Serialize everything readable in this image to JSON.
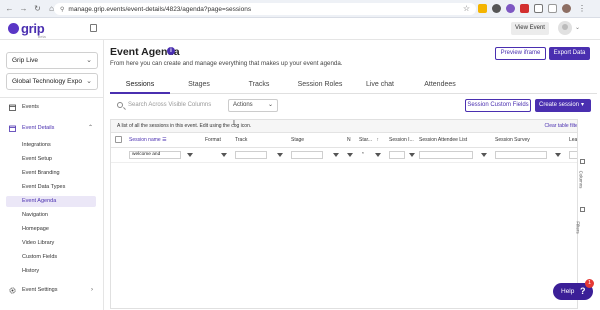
{
  "browser": {
    "url": "manage.grip.events/event-details/4823/agenda?page=sessions",
    "extension_colors": [
      "#f4b400",
      "#555555",
      "#7e57c2",
      "#d32f2f",
      "#777777"
    ]
  },
  "header": {
    "logo_text": "grip",
    "logo_sub": "beta",
    "view_event_label": "View Event"
  },
  "sidebar": {
    "org_select": "Grip Live",
    "event_select": "Global Technology Expo",
    "items": [
      {
        "label": "Events",
        "icon": "calendar-icon"
      },
      {
        "label": "Event Details",
        "icon": "calendar-icon"
      },
      {
        "label": "Integrations"
      },
      {
        "label": "Event Setup"
      },
      {
        "label": "Event Branding"
      },
      {
        "label": "Event Data Types"
      },
      {
        "label": "Event Agenda"
      },
      {
        "label": "Navigation"
      },
      {
        "label": "Homepage"
      },
      {
        "label": "Video Library"
      },
      {
        "label": "Custom Fields"
      },
      {
        "label": "History"
      },
      {
        "label": "Event Settings",
        "icon": "gear-icon"
      }
    ]
  },
  "main": {
    "title": "Event Agenda",
    "subtitle": "From here you can create and manage everything that makes up your event agenda.",
    "preview_label": "Preview iframe",
    "export_label": "Export Data",
    "tabs": [
      "Sessions",
      "Stages",
      "Tracks",
      "Session Roles",
      "Live chat",
      "Attendees"
    ],
    "search_placeholder": "Search Across Visible Columns",
    "actions_label": "Actions",
    "custom_fields_label": "Session Custom Fields",
    "create_label": "Create session",
    "notice": "A list of all the sessions in this event. Edit using the cog icon.",
    "clear_filters": "Clear table filters",
    "columns": [
      "Session name",
      "Format",
      "Track",
      "Stage",
      "N",
      "Star...",
      "Session I...",
      "Session Attendee List",
      "Session Survey",
      "Learn"
    ],
    "filter_session_name": "welcome and",
    "filter_star": "*",
    "rail_columns": "Columns",
    "rail_filters": "Filters"
  },
  "help": {
    "label": "Help",
    "q": "?",
    "badge": "1"
  },
  "colors": {
    "accent": "#4a2fb0",
    "help_bg": "#3b1f97",
    "badge": "#e53935"
  }
}
